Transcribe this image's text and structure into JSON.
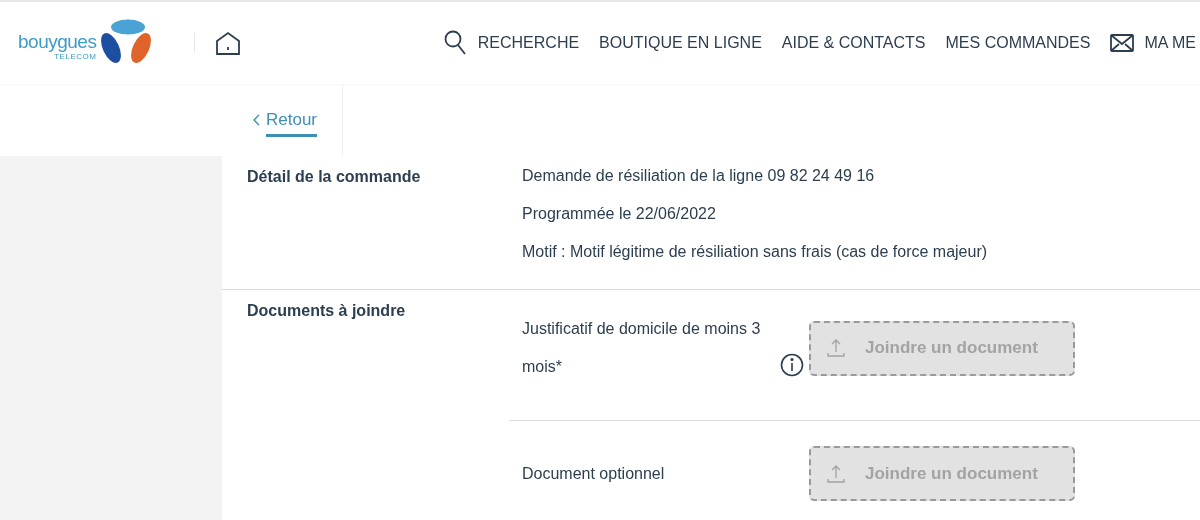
{
  "logo": {
    "name": "bouygues",
    "sub": "TELECOM"
  },
  "nav": [
    {
      "label": "RECHERCHE"
    },
    {
      "label": "BOUTIQUE EN LIGNE"
    },
    {
      "label": "AIDE & CONTACTS"
    },
    {
      "label": "MES COMMANDES"
    },
    {
      "label": "MA ME"
    }
  ],
  "back_link": "Retour",
  "sections": [
    {
      "title": "Détail de la commande",
      "lines": [
        "Demande de résiliation de la ligne 09 82 24 49 16",
        "Programmée le 22/06/2022",
        "Motif : Motif légitime de résiliation sans frais (cas de force majeur)"
      ]
    },
    {
      "title": "Documents à joindre",
      "documents": [
        {
          "label": "Justificatif de domicile de moins 3 mois*",
          "info": true,
          "button": "Joindre un document",
          "disabled": true
        },
        {
          "label": "Document optionnel",
          "info": false,
          "button": "Joindre un document",
          "disabled": true
        }
      ]
    }
  ]
}
